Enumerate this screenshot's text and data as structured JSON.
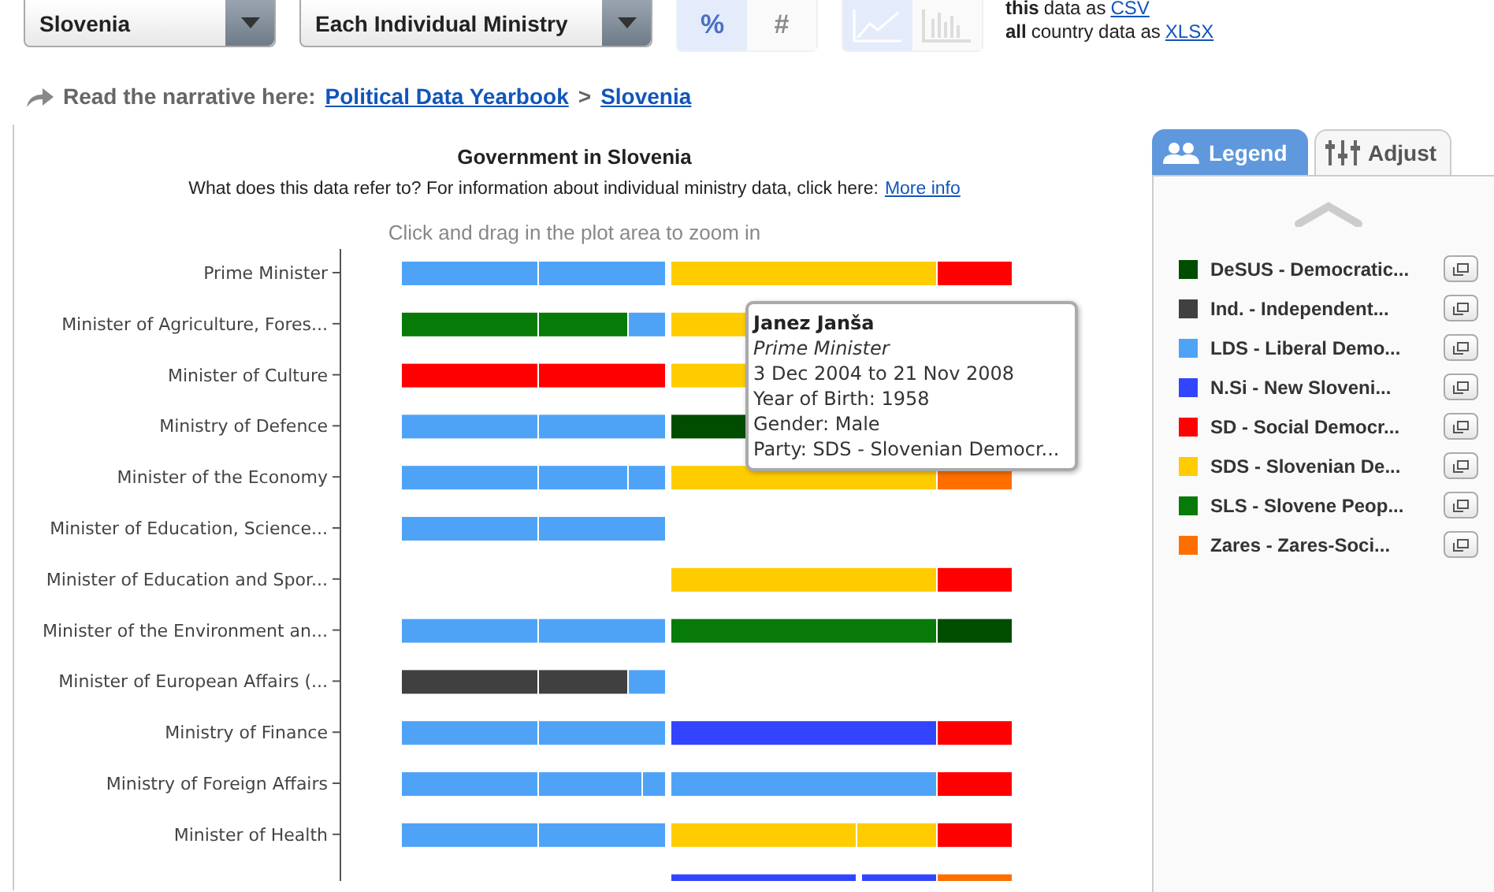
{
  "filters": {
    "country": "Slovenia",
    "view": "Each Individual Ministry"
  },
  "value_toggle": [
    {
      "label": "%",
      "selected": true
    },
    {
      "label": "#",
      "selected": false
    }
  ],
  "chart_type_toggle": [
    {
      "kind": "line",
      "selected": true
    },
    {
      "kind": "bar",
      "selected": false
    }
  ],
  "downloads": [
    {
      "scope": "this",
      "text": "data as",
      "link": "CSV"
    },
    {
      "scope": "all",
      "text": "country data as",
      "link": "XLSX"
    }
  ],
  "narrative": {
    "label": "Read the narrative here:",
    "links": [
      "Political Data Yearbook",
      "Slovenia"
    ],
    "separator": ">"
  },
  "chart": {
    "title": "Government in Slovenia",
    "subtitle": "What does this data refer to? For information about individual ministry data, click here:",
    "subtitle_link": "More info",
    "hint": "Click and drag in the plot area to zoom in",
    "rows": [
      "Prime Minister",
      "Minister of Agriculture, Fores...",
      "Minister of Culture",
      "Ministry of Defence",
      "Minister of the Economy",
      "Minister of Education, Science...",
      "Minister of Education and Spor...",
      "Minister of the Environment an...",
      "Minister of European Affairs (...",
      "Ministry of Finance",
      "Ministry of Foreign Affairs",
      "Minister of Health"
    ]
  },
  "tooltip": {
    "name": "Janez Janša",
    "role": "Prime Minister",
    "period": "3 Dec 2004 to 21 Nov 2008",
    "birth": "Year of Birth: 1958",
    "gender": "Gender: Male",
    "party": "Party: SDS - Slovenian Democr..."
  },
  "legend_tabs": [
    {
      "kind": "legend",
      "label": "Legend",
      "selected": true
    },
    {
      "kind": "adjust",
      "label": "Adjust",
      "selected": false
    }
  ],
  "legend": [
    {
      "label": "DeSUS - Democratic...",
      "color": "#004d00"
    },
    {
      "label": "Ind. - Independent...",
      "color": "#404040"
    },
    {
      "label": "LDS - Liberal Demo...",
      "color": "#4fa3f7"
    },
    {
      "label": "N.Si - New Sloveni...",
      "color": "#3344ff"
    },
    {
      "label": "SD - Social Democr...",
      "color": "#ff0000"
    },
    {
      "label": "SDS - Slovenian De...",
      "color": "#ffcc00"
    },
    {
      "label": "SLS - Slovene Peop...",
      "color": "#077a07"
    },
    {
      "label": "Zares - Zares-Soci...",
      "color": "#ff6f00"
    }
  ]
}
